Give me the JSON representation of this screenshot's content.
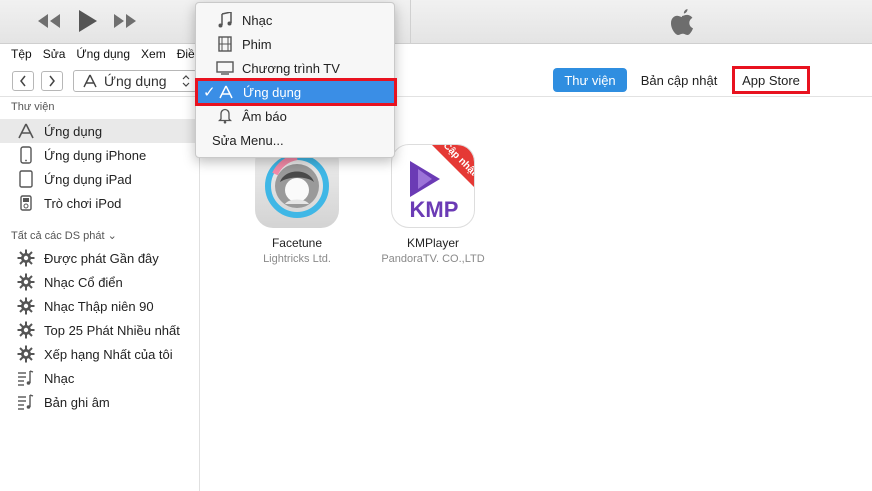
{
  "menubar": [
    "Tệp",
    "Sửa",
    "Ứng dụng",
    "Xem",
    "Điề"
  ],
  "nav": {
    "back_icon": "chevron-left-icon",
    "forward_icon": "chevron-right-icon",
    "media_kind": "Ứng dụng"
  },
  "tabs": {
    "library": "Thư viện",
    "updates": "Bản cập nhật",
    "store": "App Store"
  },
  "sidebar": {
    "library_heading": "Thư viện",
    "library_items": [
      {
        "label": "Ứng dụng",
        "icon": "apps-icon",
        "selected": true
      },
      {
        "label": "Ứng dụng iPhone",
        "icon": "iphone-icon"
      },
      {
        "label": "Ứng dụng iPad",
        "icon": "ipad-icon"
      },
      {
        "label": "Trò chơi iPod",
        "icon": "ipod-icon"
      }
    ],
    "playlists_heading": "Tất cả các DS phát ⌄",
    "playlists": [
      {
        "label": "Được phát Gần đây",
        "icon": "gear-icon"
      },
      {
        "label": "Nhạc Cổ điển",
        "icon": "gear-icon"
      },
      {
        "label": "Nhạc Thập niên 90",
        "icon": "gear-icon"
      },
      {
        "label": "Top 25 Phát Nhiều nhất",
        "icon": "gear-icon"
      },
      {
        "label": "Xếp hạng Nhất của tôi",
        "icon": "gear-icon"
      },
      {
        "label": "Nhạc",
        "icon": "playlist-icon"
      },
      {
        "label": "Bản ghi âm",
        "icon": "playlist-icon"
      }
    ]
  },
  "apps": [
    {
      "name": "Facetune",
      "developer": "Lightricks Ltd."
    },
    {
      "name": "KMPlayer",
      "developer": "PandoraTV. CO.,LTD",
      "badge": "Cập nhật",
      "logo_text": "KMP"
    }
  ],
  "dropdown": {
    "items": [
      {
        "label": "Nhạc",
        "icon": "music-note-icon"
      },
      {
        "label": "Phim",
        "icon": "film-icon"
      },
      {
        "label": "Chương trình TV",
        "icon": "tv-icon"
      },
      {
        "label": "Ứng dụng",
        "icon": "apps-icon",
        "checked": true
      },
      {
        "label": "Âm báo",
        "icon": "bell-icon"
      },
      {
        "label": "Sửa Menu..."
      }
    ]
  },
  "colors": {
    "accent": "#2f8ee0",
    "highlight_outline": "#e8121f",
    "kmp_purple": "#6b3bb5"
  }
}
